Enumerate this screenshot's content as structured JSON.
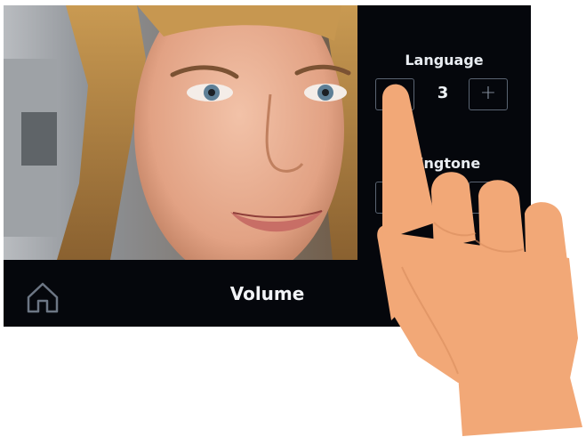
{
  "settings": {
    "language": {
      "label": "Language",
      "value": "3",
      "decrement_symbol": "−",
      "increment_symbol": "+"
    },
    "ringtone": {
      "label": "Ringtone",
      "decrement_symbol": "−",
      "increment_symbol": "+"
    }
  },
  "bottom_bar": {
    "title": "Volume",
    "home_icon": "home-icon"
  },
  "colors": {
    "screen_background": "#05070c",
    "text": "#e9edf2",
    "button_border": "#5a6472",
    "hand_skin": "#f2a877"
  }
}
